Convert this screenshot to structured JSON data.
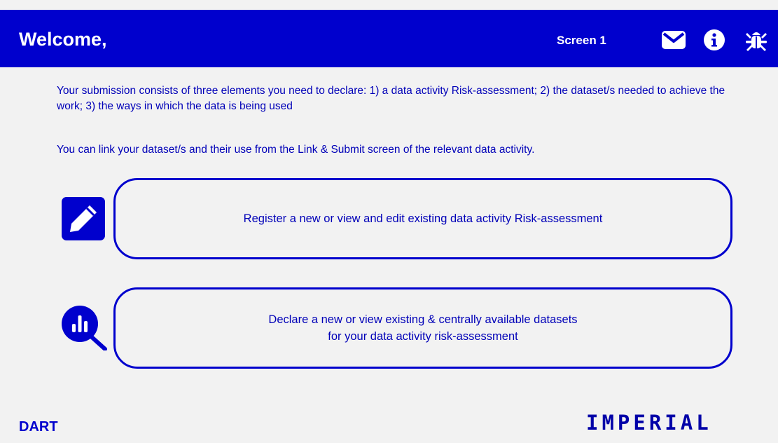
{
  "header": {
    "title": "Welcome,",
    "screen_label": "Screen 1",
    "icons": [
      "envelope-icon",
      "info-icon",
      "bug-icon"
    ]
  },
  "intro": {
    "paragraph1": "Your submission consists of three elements you need to declare: 1) a data activity Risk-assessment; 2) the dataset/s needed to achieve the work; 3) the ways in which the data is being used",
    "paragraph2": "You can link your dataset/s and their use from the Link & Submit screen of the relevant data activity."
  },
  "actions": [
    {
      "icon": "edit-icon",
      "lines": [
        "Register a new or view and edit existing data activity Risk-assessment"
      ]
    },
    {
      "icon": "dataset-search-icon",
      "lines": [
        "Declare a new or view existing & centrally available datasets",
        "for your data activity risk-assessment"
      ]
    }
  ],
  "footer": {
    "app_name": "DART",
    "logo_text": "IMPERIAL"
  },
  "colors": {
    "primary": "#0000cd",
    "text": "#0000b8",
    "background": "#f2f2f2"
  }
}
